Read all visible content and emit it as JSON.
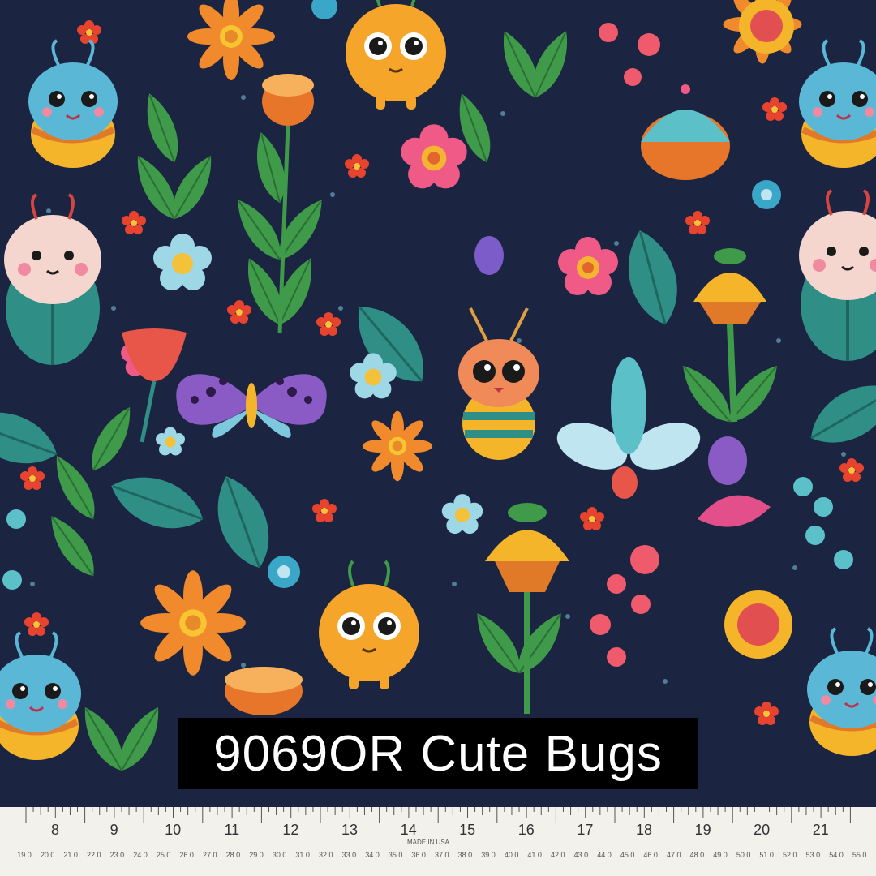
{
  "caption": {
    "text": "9069OR Cute Bugs"
  },
  "ruler": {
    "inch_labels": [
      "8",
      "9",
      "10",
      "11",
      "12",
      "13",
      "14",
      "15",
      "16",
      "17",
      "18",
      "19",
      "20",
      "21"
    ],
    "cm_labels": [
      "19.0",
      "20.0",
      "21.0",
      "22.0",
      "23.0",
      "24.0",
      "25.0",
      "26.0",
      "27.0",
      "28.0",
      "29.0",
      "30.0",
      "31.0",
      "32.0",
      "33.0",
      "34.0",
      "35.0",
      "36.0",
      "37.0",
      "38.0",
      "39.0",
      "40.0",
      "41.0",
      "42.0",
      "43.0",
      "44.0",
      "45.0",
      "46.0",
      "47.0",
      "48.0",
      "49.0",
      "50.0",
      "51.0",
      "52.0",
      "53.0",
      "54.0",
      "55.0"
    ],
    "imprint": "MADE IN USA"
  },
  "colors": {
    "background": "#1b2440",
    "leaf_green": "#3f9a4a",
    "leaf_teal": "#2f8f86",
    "orange": "#f08a2c",
    "yellow": "#f5b52a",
    "pink": "#ef5a86",
    "blue_bug": "#5ab7d6",
    "purple": "#8a5bc4",
    "ruler": "#f3f1ec"
  },
  "icons": [
    "ladybug-icon",
    "beetle-icon",
    "butterfly-icon",
    "dragonfly-icon",
    "flower-icon",
    "leaf-icon"
  ]
}
